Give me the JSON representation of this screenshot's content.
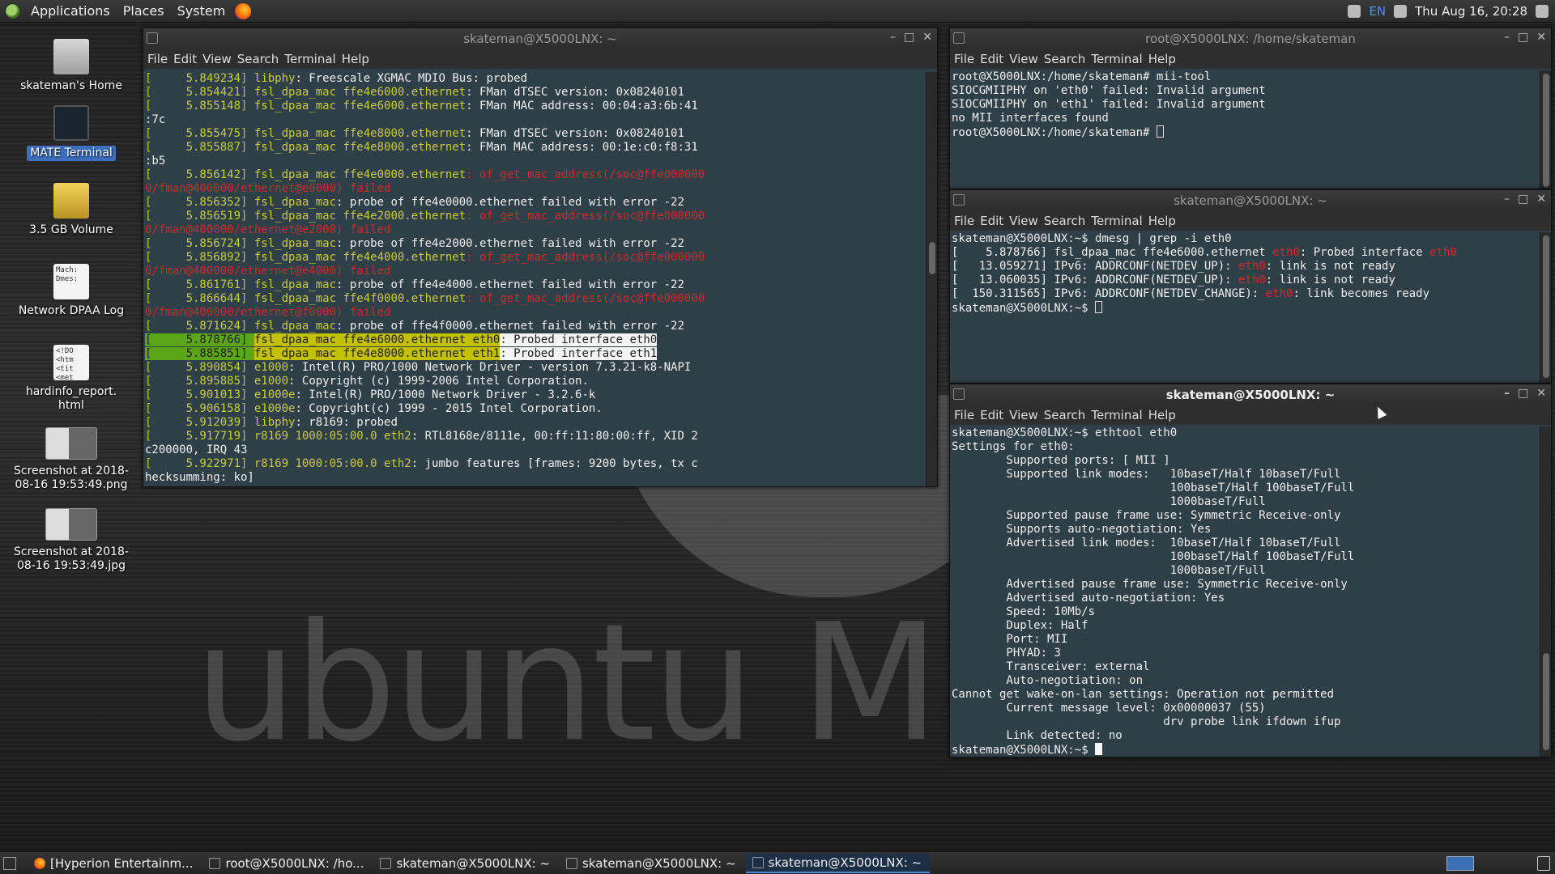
{
  "top_panel": {
    "menus": [
      "Applications",
      "Places",
      "System"
    ],
    "keyboard_layout": "EN",
    "clock": "Thu Aug 16, 20:28"
  },
  "desktop_icons": [
    {
      "label": "skateman's Home"
    },
    {
      "label": "MATE Terminal"
    },
    {
      "label": "3.5 GB Volume"
    },
    {
      "label": "Network DPAA Log",
      "preview": "Mach:\nDmes:"
    },
    {
      "label": "hardinfo_report.\nhtml",
      "preview": "<!DO\n<htm\n<tit\n<met"
    },
    {
      "label": "Screenshot at 2018-\n08-16 19:53:49.png"
    },
    {
      "label": "Screenshot at 2018-\n08-16 19:53:49.jpg"
    }
  ],
  "terminal_menu": [
    "File",
    "Edit",
    "View",
    "Search",
    "Terminal",
    "Help"
  ],
  "win1": {
    "title": "skateman@X5000LNX: ~",
    "lines": [
      [
        {
          "t": "[ ",
          "c": "br"
        },
        {
          "t": "    5.849234",
          "c": "ts"
        },
        {
          "t": "] ",
          "c": "br"
        },
        {
          "t": "libphy",
          "c": "yl"
        },
        {
          "t": ": Freescale XGMAC MDIO Bus: probed"
        }
      ],
      [
        {
          "t": "[ ",
          "c": "br"
        },
        {
          "t": "    5.854421",
          "c": "ts"
        },
        {
          "t": "] ",
          "c": "br"
        },
        {
          "t": "fsl_dpaa_mac ffe4e6000.ethernet",
          "c": "yl"
        },
        {
          "t": ": FMan dTSEC version: 0x08240101"
        }
      ],
      [
        {
          "t": "[ ",
          "c": "br"
        },
        {
          "t": "    5.855148",
          "c": "ts"
        },
        {
          "t": "] ",
          "c": "br"
        },
        {
          "t": "fsl_dpaa_mac ffe4e6000.ethernet",
          "c": "yl"
        },
        {
          "t": ": FMan MAC address: 00:04:a3:6b:41"
        }
      ],
      [
        {
          "t": ":7c"
        }
      ],
      [
        {
          "t": "[ ",
          "c": "br"
        },
        {
          "t": "    5.855475",
          "c": "ts"
        },
        {
          "t": "] ",
          "c": "br"
        },
        {
          "t": "fsl_dpaa_mac ffe4e8000.ethernet",
          "c": "yl"
        },
        {
          "t": ": FMan dTSEC version: 0x08240101"
        }
      ],
      [
        {
          "t": "[ ",
          "c": "br"
        },
        {
          "t": "    5.855887",
          "c": "ts"
        },
        {
          "t": "] ",
          "c": "br"
        },
        {
          "t": "fsl_dpaa_mac ffe4e8000.ethernet",
          "c": "yl"
        },
        {
          "t": ": FMan MAC address: 00:1e:c0:f8:31"
        }
      ],
      [
        {
          "t": ":b5"
        }
      ],
      [
        {
          "t": "[ ",
          "c": "br"
        },
        {
          "t": "    5.856142",
          "c": "ts"
        },
        {
          "t": "] ",
          "c": "br"
        },
        {
          "t": "fsl_dpaa_mac ffe4e0000.ethernet",
          "c": "yl"
        },
        {
          "t": ": of_get_mac_address(/soc@ffe000000",
          "c": "rd"
        }
      ],
      [
        {
          "t": "0/fman@400000/ethernet@e0000) failed",
          "c": "rd"
        }
      ],
      [
        {
          "t": "[ ",
          "c": "br"
        },
        {
          "t": "    5.856352",
          "c": "ts"
        },
        {
          "t": "] ",
          "c": "br"
        },
        {
          "t": "fsl_dpaa_mac",
          "c": "yl"
        },
        {
          "t": ": probe of ffe4e0000.ethernet failed with error -22"
        }
      ],
      [
        {
          "t": "[ ",
          "c": "br"
        },
        {
          "t": "    5.856519",
          "c": "ts"
        },
        {
          "t": "] ",
          "c": "br"
        },
        {
          "t": "fsl_dpaa_mac ffe4e2000.ethernet",
          "c": "yl"
        },
        {
          "t": ": of_get_mac_address(/soc@ffe000000",
          "c": "rd"
        }
      ],
      [
        {
          "t": "0/fman@400000/ethernet@e2000) failed",
          "c": "rd"
        }
      ],
      [
        {
          "t": "[ ",
          "c": "br"
        },
        {
          "t": "    5.856724",
          "c": "ts"
        },
        {
          "t": "] ",
          "c": "br"
        },
        {
          "t": "fsl_dpaa_mac",
          "c": "yl"
        },
        {
          "t": ": probe of ffe4e2000.ethernet failed with error -22"
        }
      ],
      [
        {
          "t": "[ ",
          "c": "br"
        },
        {
          "t": "    5.856892",
          "c": "ts"
        },
        {
          "t": "] ",
          "c": "br"
        },
        {
          "t": "fsl_dpaa_mac ffe4e4000.ethernet",
          "c": "yl"
        },
        {
          "t": ": of_get_mac_address(/soc@ffe000000",
          "c": "rd"
        }
      ],
      [
        {
          "t": "0/fman@400000/ethernet@e4000) failed",
          "c": "rd"
        }
      ],
      [
        {
          "t": "[ ",
          "c": "br"
        },
        {
          "t": "    5.861761",
          "c": "ts"
        },
        {
          "t": "] ",
          "c": "br"
        },
        {
          "t": "fsl_dpaa_mac",
          "c": "yl"
        },
        {
          "t": ": probe of ffe4e4000.ethernet failed with error -22"
        }
      ],
      [
        {
          "t": "[ ",
          "c": "br"
        },
        {
          "t": "    5.866644",
          "c": "ts"
        },
        {
          "t": "] ",
          "c": "br"
        },
        {
          "t": "fsl_dpaa_mac ffe4f0000.ethernet",
          "c": "yl"
        },
        {
          "t": ": of_get_mac_address(/soc@ffe000000",
          "c": "rd"
        }
      ],
      [
        {
          "t": "0/fman@400000/ethernet@f0000) failed",
          "c": "rd"
        }
      ],
      [
        {
          "t": "[ ",
          "c": "br"
        },
        {
          "t": "    5.871624",
          "c": "ts"
        },
        {
          "t": "] ",
          "c": "br"
        },
        {
          "t": "fsl_dpaa_mac",
          "c": "yl"
        },
        {
          "t": ": probe of ffe4f0000.ethernet failed with error -22"
        }
      ],
      [
        {
          "t": "[ ",
          "c": "hl-g"
        },
        {
          "t": "    5.878766",
          "c": "hl-g"
        },
        {
          "t": "] ",
          "c": "hl-g"
        },
        {
          "t": "fsl_dpaa_mac ffe4e6000.ethernet eth0",
          "c": "hl-y"
        },
        {
          "t": ": Probed interface eth0",
          "c": "hl"
        }
      ],
      [
        {
          "t": "[ ",
          "c": "hl-g"
        },
        {
          "t": "    5.885851",
          "c": "hl-g"
        },
        {
          "t": "] ",
          "c": "hl-g"
        },
        {
          "t": "fsl_dpaa_mac ffe4e8000.ethernet eth1",
          "c": "hl-y"
        },
        {
          "t": ": Probed interface eth1",
          "c": "hl"
        }
      ],
      [
        {
          "t": "[ ",
          "c": "br"
        },
        {
          "t": "    5.890854",
          "c": "ts"
        },
        {
          "t": "] ",
          "c": "br"
        },
        {
          "t": "e1000",
          "c": "yl"
        },
        {
          "t": ": Intel(R) PRO/1000 Network Driver - version 7.3.21-k8-NAPI"
        }
      ],
      [
        {
          "t": "[ ",
          "c": "br"
        },
        {
          "t": "    5.895885",
          "c": "ts"
        },
        {
          "t": "] ",
          "c": "br"
        },
        {
          "t": "e1000",
          "c": "yl"
        },
        {
          "t": ": Copyright (c) 1999-2006 Intel Corporation."
        }
      ],
      [
        {
          "t": "[ ",
          "c": "br"
        },
        {
          "t": "    5.901013",
          "c": "ts"
        },
        {
          "t": "] ",
          "c": "br"
        },
        {
          "t": "e1000e",
          "c": "yl"
        },
        {
          "t": ": Intel(R) PRO/1000 Network Driver - 3.2.6-k"
        }
      ],
      [
        {
          "t": "[ ",
          "c": "br"
        },
        {
          "t": "    5.906158",
          "c": "ts"
        },
        {
          "t": "] ",
          "c": "br"
        },
        {
          "t": "e1000e",
          "c": "yl"
        },
        {
          "t": ": Copyright(c) 1999 - 2015 Intel Corporation."
        }
      ],
      [
        {
          "t": "[ ",
          "c": "br"
        },
        {
          "t": "    5.912039",
          "c": "ts"
        },
        {
          "t": "] ",
          "c": "br"
        },
        {
          "t": "libphy",
          "c": "yl"
        },
        {
          "t": ": r8169: probed"
        }
      ],
      [
        {
          "t": "[ ",
          "c": "br"
        },
        {
          "t": "    5.917719",
          "c": "ts"
        },
        {
          "t": "] ",
          "c": "br"
        },
        {
          "t": "r8169 1000:05:00.0 eth2",
          "c": "yl"
        },
        {
          "t": ": RTL8168e/8111e, 00:ff:11:80:00:ff, XID 2"
        }
      ],
      [
        {
          "t": "c200000, IRQ 43"
        }
      ],
      [
        {
          "t": "[ ",
          "c": "br"
        },
        {
          "t": "    5.922971",
          "c": "ts"
        },
        {
          "t": "] ",
          "c": "br"
        },
        {
          "t": "r8169 1000:05:00.0 eth2",
          "c": "yl"
        },
        {
          "t": ": jumbo features [frames: 9200 bytes, tx c"
        }
      ],
      [
        {
          "t": "hecksumming: ko]"
        }
      ]
    ]
  },
  "win2": {
    "title": "root@X5000LNX: /home/skateman",
    "lines": [
      [
        {
          "t": "root@X5000LNX:/home/skateman# mii-tool"
        }
      ],
      [
        {
          "t": "SIOCGMIIPHY on 'eth0' failed: Invalid argument"
        }
      ],
      [
        {
          "t": "SIOCGMIIPHY on 'eth1' failed: Invalid argument"
        }
      ],
      [
        {
          "t": "no MII interfaces found"
        }
      ],
      [
        {
          "t": "root@X5000LNX:/home/skateman# "
        },
        {
          "cursor": "o"
        }
      ]
    ]
  },
  "win3": {
    "title": "skateman@X5000LNX: ~",
    "lines": [
      [
        {
          "t": "skateman@X5000LNX:~$ dmesg | grep -i eth0"
        }
      ],
      [
        {
          "t": "[    5.878766] fsl_dpaa_mac ffe4e6000.ethernet "
        },
        {
          "t": "eth0",
          "c": "rd"
        },
        {
          "t": ": Probed interface "
        },
        {
          "t": "eth0",
          "c": "rd"
        }
      ],
      [
        {
          "t": "[   13.059271] IPv6: ADDRCONF(NETDEV_UP): "
        },
        {
          "t": "eth0",
          "c": "rd"
        },
        {
          "t": ": link is not ready"
        }
      ],
      [
        {
          "t": "[   13.060035] IPv6: ADDRCONF(NETDEV_UP): "
        },
        {
          "t": "eth0",
          "c": "rd"
        },
        {
          "t": ": link is not ready"
        }
      ],
      [
        {
          "t": "[  150.311565] IPv6: ADDRCONF(NETDEV_CHANGE): "
        },
        {
          "t": "eth0",
          "c": "rd"
        },
        {
          "t": ": link becomes ready"
        }
      ],
      [
        {
          "t": "skateman@X5000LNX:~$ "
        },
        {
          "cursor": "o"
        }
      ]
    ]
  },
  "win4": {
    "title": "skateman@X5000LNX: ~",
    "lines": [
      [
        {
          "t": "skateman@X5000LNX:~$ ethtool eth0"
        }
      ],
      [
        {
          "t": "Settings for eth0:"
        }
      ],
      [
        {
          "t": "        Supported ports: [ MII ]"
        }
      ],
      [
        {
          "t": "        Supported link modes:   10baseT/Half 10baseT/Full"
        }
      ],
      [
        {
          "t": "                                100baseT/Half 100baseT/Full"
        }
      ],
      [
        {
          "t": "                                1000baseT/Full"
        }
      ],
      [
        {
          "t": "        Supported pause frame use: Symmetric Receive-only"
        }
      ],
      [
        {
          "t": "        Supports auto-negotiation: Yes"
        }
      ],
      [
        {
          "t": "        Advertised link modes:  10baseT/Half 10baseT/Full"
        }
      ],
      [
        {
          "t": "                                100baseT/Half 100baseT/Full"
        }
      ],
      [
        {
          "t": "                                1000baseT/Full"
        }
      ],
      [
        {
          "t": "        Advertised pause frame use: Symmetric Receive-only"
        }
      ],
      [
        {
          "t": "        Advertised auto-negotiation: Yes"
        }
      ],
      [
        {
          "t": "        Speed: 10Mb/s"
        }
      ],
      [
        {
          "t": "        Duplex: Half"
        }
      ],
      [
        {
          "t": "        Port: MII"
        }
      ],
      [
        {
          "t": "        PHYAD: 3"
        }
      ],
      [
        {
          "t": "        Transceiver: external"
        }
      ],
      [
        {
          "t": "        Auto-negotiation: on"
        }
      ],
      [
        {
          "t": "Cannot get wake-on-lan settings: Operation not permitted"
        }
      ],
      [
        {
          "t": "        Current message level: 0x00000037 (55)"
        }
      ],
      [
        {
          "t": "                               drv probe link ifdown ifup"
        }
      ],
      [
        {
          "t": "        Link detected: no"
        }
      ],
      [
        {
          "t": "skateman@X5000LNX:~$ "
        },
        {
          "cursor": "f"
        }
      ]
    ]
  },
  "taskbar": [
    {
      "label": "[Hyperion Entertainm...",
      "icon": "firefox-icon",
      "active": false
    },
    {
      "label": "root@X5000LNX: /ho...",
      "icon": "terminal-icon",
      "active": false
    },
    {
      "label": "skateman@X5000LNX: ~",
      "icon": "terminal-icon",
      "active": false
    },
    {
      "label": "skateman@X5000LNX: ~",
      "icon": "terminal-icon",
      "active": false
    },
    {
      "label": "skateman@X5000LNX: ~",
      "icon": "terminal-icon",
      "active": true
    }
  ]
}
